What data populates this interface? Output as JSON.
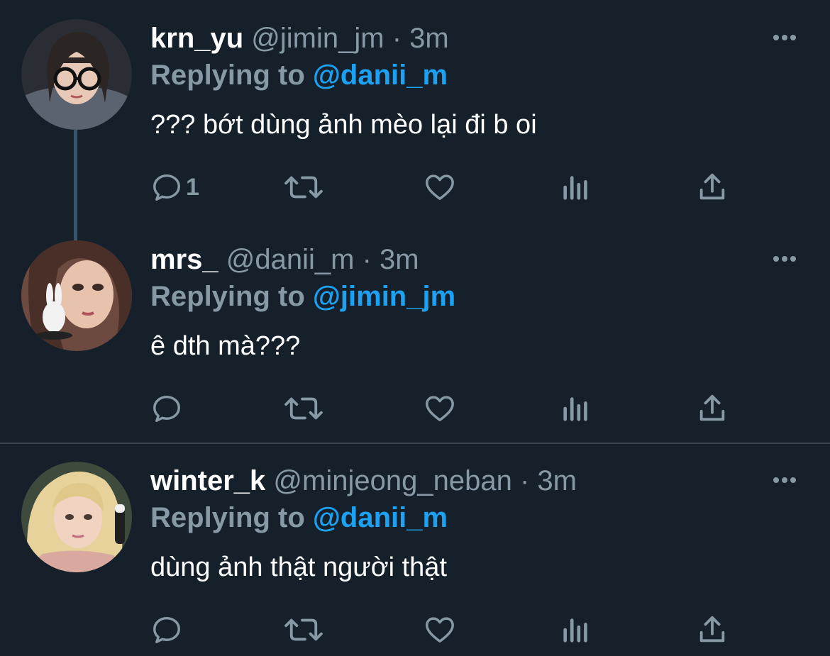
{
  "colors": {
    "background": "#15202b",
    "name_text": "#ffffff",
    "secondary_text": "#8899a6",
    "mention": "#1da1f2",
    "divider": "#38444d",
    "thread_line": "#3d5466"
  },
  "icons": {
    "reply": "reply-icon",
    "retweet": "retweet-icon",
    "like": "heart-icon",
    "views": "views-icon",
    "share": "share-icon",
    "more": "more-icon"
  },
  "tweets": [
    {
      "name": "krn_yu",
      "handle": "@jimin_jm",
      "dot": "·",
      "time": "3m",
      "replying_prefix": "Replying to ",
      "replying_to": "@danii_m",
      "text": "??? bớt dùng ảnh mèo lại đi b oi",
      "reply_count": "1"
    },
    {
      "name": "mrs_",
      "handle": "@danii_m",
      "dot": "·",
      "time": "3m",
      "replying_prefix": "Replying to ",
      "replying_to": "@jimin_jm",
      "text": "ê dth mà???",
      "reply_count": ""
    },
    {
      "name": "winter_k",
      "handle": "@minjeong_neban",
      "dot": "·",
      "time": "3m",
      "replying_prefix": "Replying to ",
      "replying_to": "@danii_m",
      "text": "dùng ảnh thật người thật",
      "reply_count": ""
    }
  ]
}
